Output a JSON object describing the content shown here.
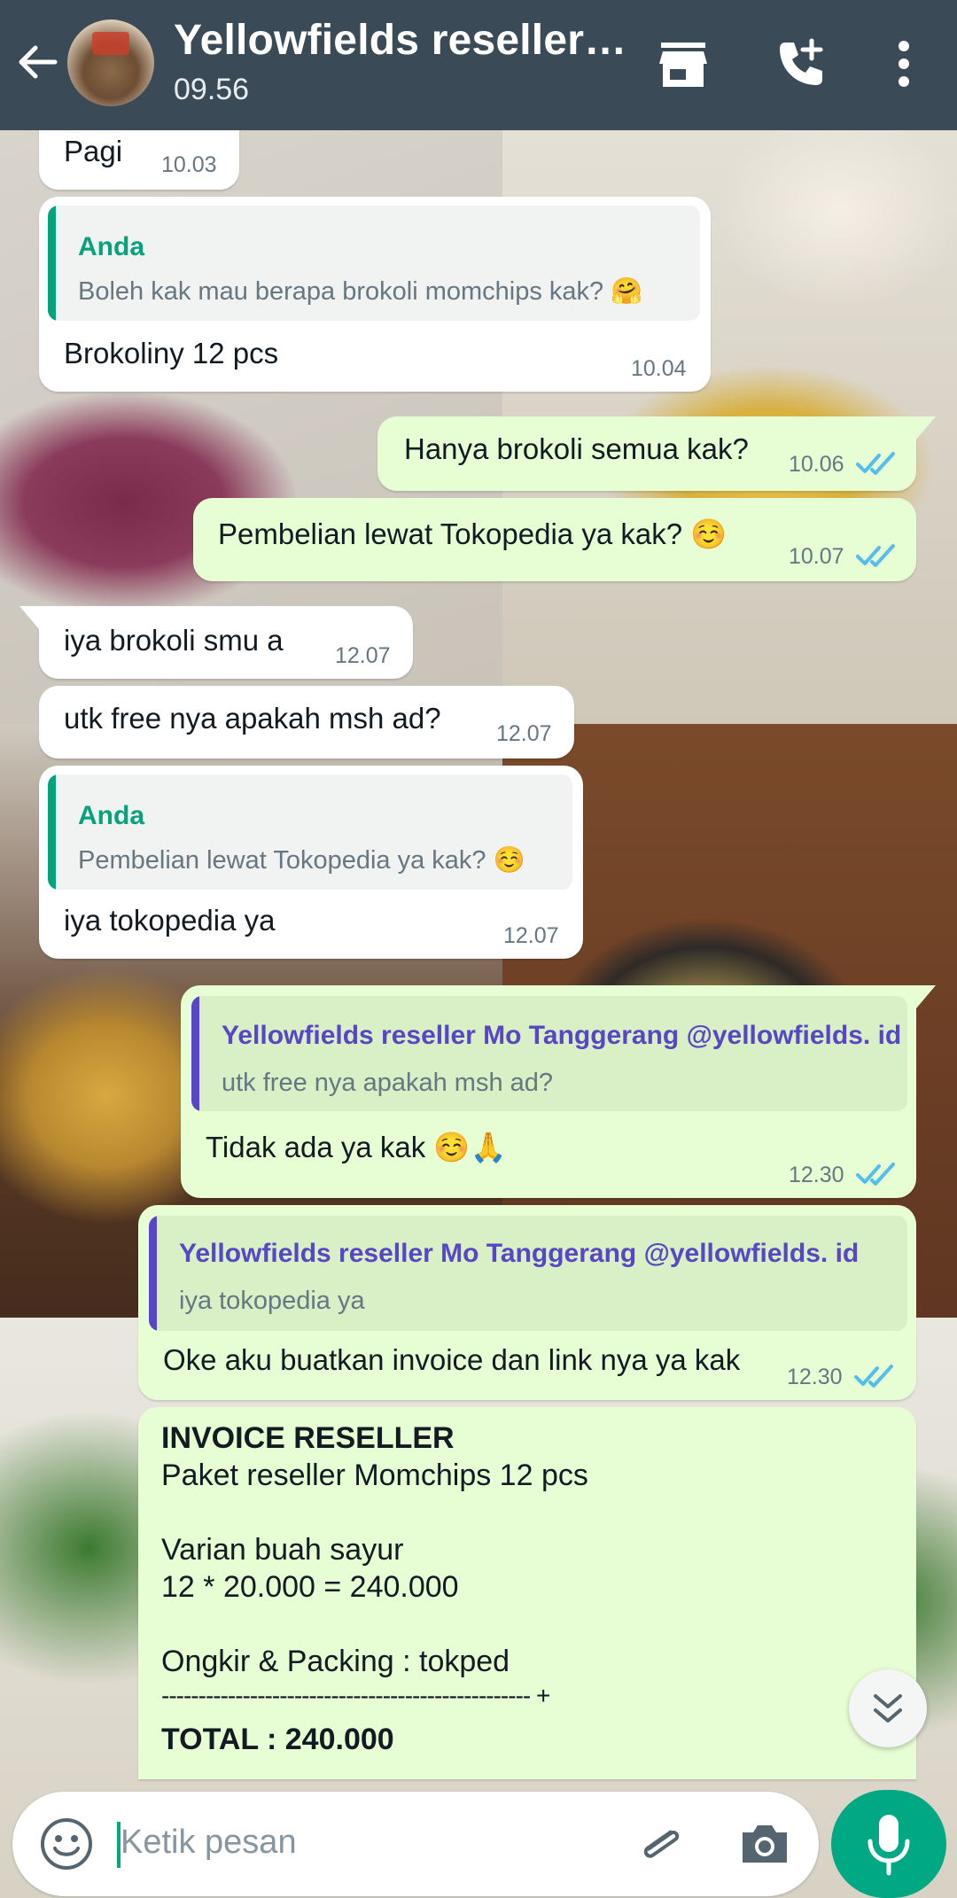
{
  "header": {
    "title": "Yellowfields reseller…",
    "subtitle": "09.56"
  },
  "messages": [
    {
      "text": "Pagi",
      "time": "10.03"
    },
    {
      "quote_author": "Anda",
      "quote_text": "Boleh kak mau berapa brokoli momchips kak? 🤗",
      "text": "Brokoliny 12 pcs",
      "time": "10.04"
    },
    {
      "text": "Hanya brokoli semua kak?",
      "time": "10.06"
    },
    {
      "text": "Pembelian lewat Tokopedia ya kak? ☺️",
      "time": "10.07"
    },
    {
      "text": "iya brokoli smu a",
      "time": "12.07"
    },
    {
      "text": "utk free nya apakah msh ad?",
      "time": "12.07"
    },
    {
      "quote_author": "Anda",
      "quote_text": "Pembelian lewat Tokopedia ya kak? ☺️",
      "text": "iya tokopedia ya",
      "time": "12.07"
    },
    {
      "quote_author": "Yellowfields reseller Mo Tanggerang @yellowfields. id",
      "quote_text": "utk free nya apakah msh ad?",
      "text": "Tidak ada ya kak ☺️🙏",
      "time": "12.30"
    },
    {
      "quote_author": "Yellowfields reseller Mo Tanggerang @yellowfields. id",
      "quote_text": "iya tokopedia ya",
      "text": "Oke aku buatkan invoice dan link nya ya kak",
      "time": "12.30"
    }
  ],
  "invoice": {
    "title": "INVOICE RESELLER",
    "line1": "Paket reseller Momchips 12 pcs",
    "line2": "Varian buah sayur",
    "line3": " 12 * 20.000 = 240.000",
    "line4": "Ongkir & Packing : tokped",
    "line5": "-------------------------------------------------- +",
    "total": "TOTAL : 240.000"
  },
  "composer": {
    "placeholder": "Ketik pesan"
  },
  "colors": {
    "header_bg": "#3a4b57",
    "outgoing_bubble": "#e7fdd3",
    "incoming_bubble": "#ffffff",
    "accent_green": "#00a884",
    "quote_self_author": "#06a27b",
    "quote_other_author": "#5747c4",
    "read_ticks": "#53bdeb"
  },
  "icons": [
    "back-arrow-icon",
    "shop-icon",
    "add-call-icon",
    "more-vert-icon",
    "double-check-icon",
    "chevron-double-down-icon",
    "emoji-icon",
    "attach-icon",
    "camera-icon",
    "mic-icon"
  ]
}
